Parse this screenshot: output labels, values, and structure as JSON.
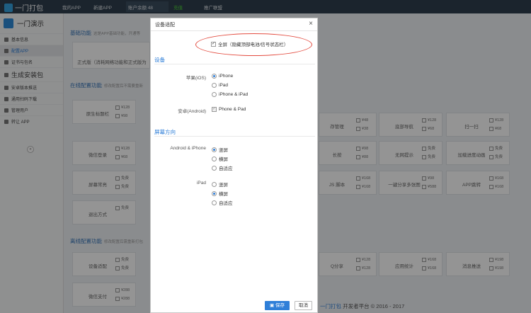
{
  "topbar": {
    "logo": "一门打包",
    "nav": [
      "我的APP",
      "新建APP",
      "账户余额 48",
      "充值",
      "推广联盟"
    ]
  },
  "sidebar": {
    "app_name": "一门演示",
    "items": [
      "基本信息",
      "配置APP",
      "证书与包名",
      "生成安装包",
      "安卓版本推送",
      "通用扫码下载",
      "管理用户",
      "转让 APP"
    ],
    "collapse": "«"
  },
  "main": {
    "basic": {
      "title": "基础功能",
      "hint": "这是APP基础功能，开通等",
      "card": "正式版（消耗网络功能和正式版为"
    },
    "online": {
      "title": "在线配置功能",
      "hint": "修改配置后不需要重新"
    },
    "offline": {
      "title": "离线配置功能",
      "hint": "修改配置后需重新打包"
    },
    "cards_left": [
      "原生标题栏",
      "微信登录",
      "屏幕常亮",
      "退出方式",
      "设备适配",
      "微信支付"
    ],
    "cards_left_prices": [
      [
        "¥128",
        "¥98"
      ],
      [
        "¥128",
        "¥68"
      ],
      [
        "免费",
        "免费"
      ],
      [
        "免费",
        ""
      ],
      [
        "免费",
        "免费"
      ],
      [
        "¥288",
        "¥288"
      ]
    ],
    "cards_mid": [
      "存管理",
      "长按",
      "JS 脚本",
      "Q分享"
    ],
    "cards_mid_prices": [
      [
        "¥48",
        "¥38"
      ],
      [
        "¥98",
        "¥88"
      ],
      [
        "¥168",
        "¥168"
      ],
      [
        "¥128",
        "¥128"
      ]
    ],
    "cards_c": [
      "底部导航",
      "无网提示",
      "一键分享多张图",
      "应用统计"
    ],
    "cards_c_prices": [
      [
        "¥128",
        "¥68"
      ],
      [
        "免费",
        "免费"
      ],
      [
        "¥98",
        "¥588"
      ],
      [
        "¥168",
        "¥168"
      ]
    ],
    "cards_r": [
      "扫一扫",
      "加载进度动画",
      "APP跳转",
      "消息推送"
    ],
    "cards_r_prices": [
      [
        "¥128",
        "¥68"
      ],
      [
        "免费",
        "免费"
      ],
      [
        "¥168",
        "¥168"
      ],
      [
        "¥198",
        "¥198"
      ]
    ],
    "footer_brand": "一门打包",
    "footer_text": " 开发者平台 © 2016 - 2017"
  },
  "modal": {
    "title": "设备适配",
    "close": "×",
    "fullscreen_label": "全屏（隐藏顶部电池/信号状态栏）",
    "device_section": "设备",
    "apple_label": "苹果(iOS)",
    "ios_options": [
      "iPhone",
      "iPad",
      "iPhone & iPad"
    ],
    "android_label": "安卓(Android)",
    "android_option": "Phone & Pad",
    "orientation_section": "屏幕方向",
    "android_iphone_label": "Android & iPhone",
    "iphone_orient": [
      "竖屏",
      "横屏",
      "自适应"
    ],
    "ipad_label": "iPad",
    "ipad_orient": [
      "竖屏",
      "横屏",
      "自适应"
    ],
    "save": "保存",
    "cancel": "取消"
  },
  "colors": {
    "accent": "#2f7fd8",
    "highlight": "#e34b3f",
    "topbar": "#2f3f4f"
  }
}
